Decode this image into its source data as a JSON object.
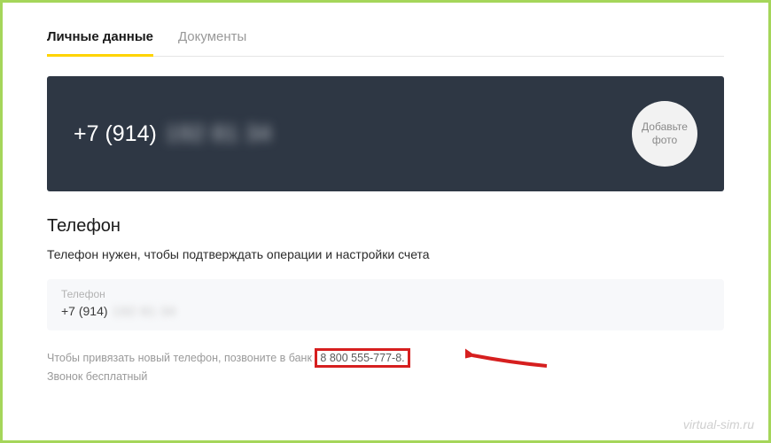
{
  "tabs": {
    "personal": "Личные данные",
    "documents": "Документы"
  },
  "hero": {
    "phone_prefix": "+7 (914)",
    "phone_masked": "192 81 34",
    "add_photo": "Добавьте фото"
  },
  "section": {
    "title": "Телефон",
    "description": "Телефон нужен, чтобы подтверждать операции и настройки счета"
  },
  "phone_box": {
    "label": "Телефон",
    "prefix": "+7 (914)",
    "masked": "192 81 34"
  },
  "note": {
    "line1_before": "Чтобы привязать новый телефон, позвоните в банк ",
    "highlighted_number": "8 800 555-777-8.",
    "line2": "Звонок бесплатный"
  },
  "watermark": "virtual-sim.ru"
}
